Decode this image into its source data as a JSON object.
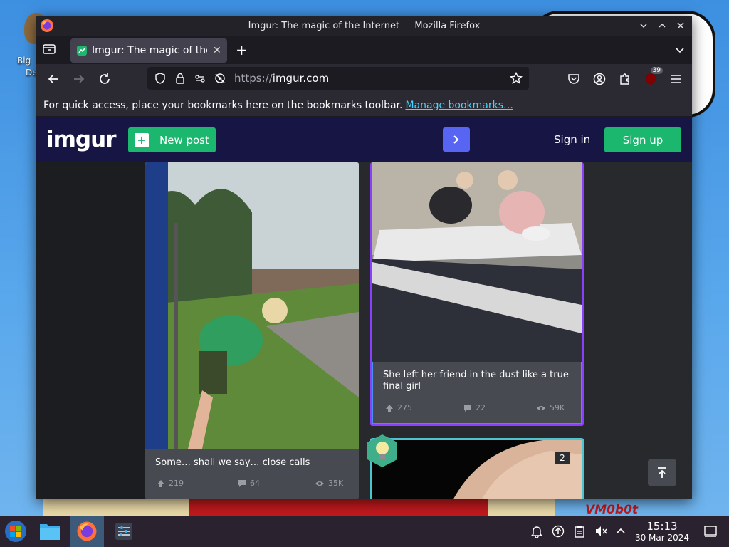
{
  "desktop": {
    "icon_label_1": "Big",
    "icon_label_2": "De",
    "wallpaper_text": "VM0b0t"
  },
  "window": {
    "title": "Imgur: The magic of the Internet — Mozilla Firefox"
  },
  "tabs": [
    {
      "label": "Imgur: The magic of the Internet",
      "active": true
    }
  ],
  "navbar": {
    "url_scheme": "https://",
    "url_host": "imgur.com",
    "extension_badge": "39"
  },
  "bookmarks_bar": {
    "message": "For quick access, place your bookmarks here on the bookmarks toolbar.",
    "link": "Manage bookmarks…"
  },
  "imgur": {
    "logo": "imgur",
    "new_post": "New post",
    "sign_in": "Sign in",
    "sign_up": "Sign up",
    "posts": [
      {
        "caption": "Some… shall we say… close calls",
        "upvotes": "219",
        "comments": "64",
        "views": "35K"
      },
      {
        "caption": "She left her friend in the dust like a true final girl",
        "upvotes": "275",
        "comments": "22",
        "views": "59K"
      },
      {
        "caption": "",
        "image_count": "2"
      }
    ]
  },
  "taskbar": {
    "time": "15:13",
    "date": "30 Mar 2024"
  },
  "colors": {
    "imgur_header": "#171544",
    "imgur_green": "#1bb76e",
    "imgur_blue": "#5865f2",
    "card_purple_border": "#8a3ffc",
    "card_teal_border": "#4ec3d0"
  }
}
